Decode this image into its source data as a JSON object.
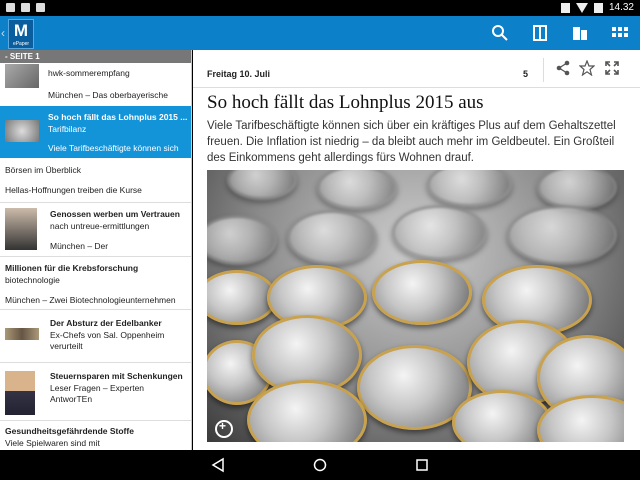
{
  "status": {
    "time": "14.32"
  },
  "app": {
    "logo_letter": "M",
    "logo_sub": "ePaper"
  },
  "icons": [
    "search-icon",
    "page-layout-icon",
    "pages-icon",
    "grid-icon",
    "share-icon",
    "star-icon",
    "fullscreen-icon",
    "zoom-icon",
    "back-icon",
    "home-icon",
    "recents-icon"
  ],
  "sidebar": {
    "section": "- SEITE 1",
    "items": [
      {
        "title": "hwk-sommerempfang",
        "snippet": "München – Das oberbayerische"
      },
      {
        "title": "So hoch fällt das Lohnplus 2015 ...",
        "sub": "Tarifbilanz",
        "snippet": "Viele Tarifbeschäftigte können sich",
        "selected": true
      },
      {
        "title": "Börsen im Überblick"
      },
      {
        "title": "Hellas-Hoffnungen treiben die Kurse"
      },
      {
        "title": "Genossen werben um Vertrauen",
        "sub": "nach untreue-ermittlungen",
        "snippet": "München – Der"
      },
      {
        "title": "Millionen für die Krebsforschung",
        "sub": "biotechnologie",
        "snippet": "München – Zwei Biotechnologieunternehmen"
      },
      {
        "title": "Der Absturz der Edelbanker",
        "sub": "Ex-Chefs von Sal. Oppenheim verurteilt"
      },
      {
        "title": "Steuernsparen mit Schenkungen",
        "sub": "Leser Fragen – Experten AntworTEn"
      },
      {
        "title": "Gesundheitsgefährdende Stoffe",
        "sub": "Viele Spielwaren sind mit"
      }
    ]
  },
  "article": {
    "date": "Freitag 10. Juli",
    "page": "5",
    "headline": "So hoch fällt das Lohnplus 2015 aus",
    "lead": "Viele Tarifbeschäftigte können sich über ein kräftiges Plus auf dem Gehaltszettel freuen. Die Inflation ist niedrig – da bleibt auch mehr im Geldbeutel. Ein Großteil des Einkommens geht allerdings fürs Wohnen drauf."
  },
  "colors": {
    "appbar": "#0c80c9",
    "selected": "#1494d8",
    "section": "#777777"
  }
}
